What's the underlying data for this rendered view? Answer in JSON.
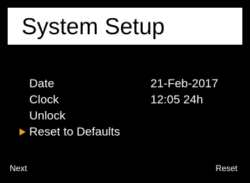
{
  "header": {
    "title": "System Setup"
  },
  "menu": {
    "items": [
      {
        "label": "Date",
        "value": "21-Feb-2017",
        "selected": false
      },
      {
        "label": "Clock",
        "value": "12:05 24h",
        "selected": false
      },
      {
        "label": "Unlock",
        "value": "",
        "selected": false
      },
      {
        "label": "Reset to Defaults",
        "value": "",
        "selected": true
      }
    ],
    "selector_icon": "triangle-right-icon",
    "selector_color": "#e8a317"
  },
  "softkeys": {
    "left_label": "Next",
    "right_label": "Reset"
  },
  "colors": {
    "background": "#000000",
    "title_bar": "#ffffff",
    "text": "#ffffff"
  }
}
